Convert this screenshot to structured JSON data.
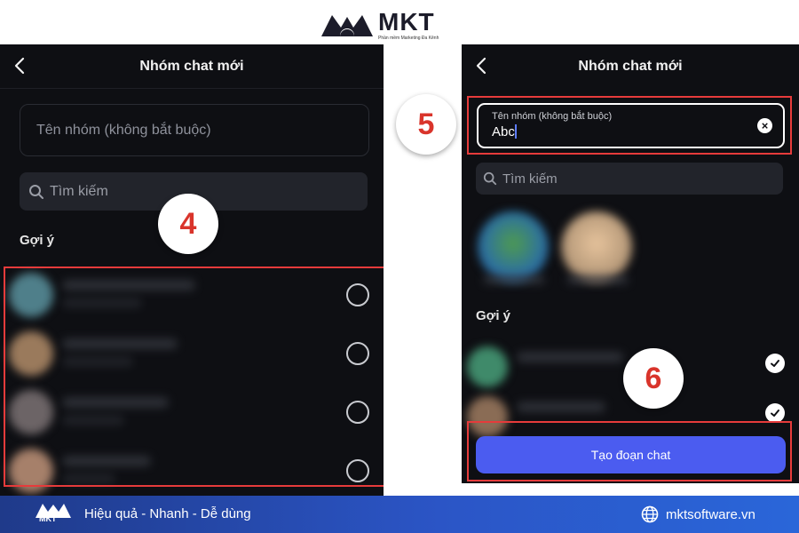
{
  "brand": {
    "name": "MKT",
    "tagline": "Phần mềm Marketing Đa Kênh"
  },
  "left": {
    "title": "Nhóm chat mới",
    "name_placeholder": "Tên nhóm (không bắt buộc)",
    "search_placeholder": "Tìm kiếm",
    "section": "Gợi ý",
    "badge": "4",
    "contact_count_shown": 4
  },
  "right": {
    "title": "Nhóm chat mới",
    "name_label": "Tên nhóm (không bắt buộc)",
    "name_value": "Abc",
    "clear_icon": "×",
    "search_placeholder": "Tìm kiếm",
    "section": "Gợi ý",
    "badge_name": "5",
    "badge_create": "6",
    "create_label": "Tạo đoạn chat"
  },
  "footer": {
    "slogan": "Hiệu quả - Nhanh - Dễ dùng",
    "site": "mktsoftware.vn",
    "logo": "MKT"
  },
  "colors": {
    "panel_bg": "#0e0f13",
    "accent": "#4b5cf0",
    "highlight": "#e63b3b",
    "footer": "#2b55c6"
  }
}
